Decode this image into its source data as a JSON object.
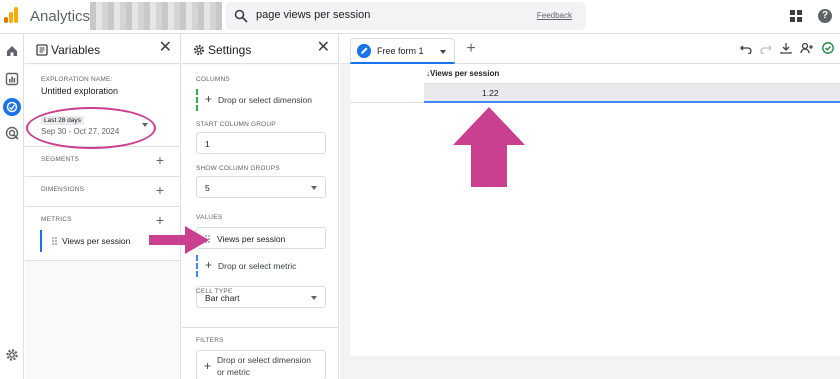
{
  "app": {
    "name": "Analytics"
  },
  "search": {
    "query": "page views per session",
    "feedback_label": "Feedback"
  },
  "variables": {
    "title": "Variables",
    "exploration_label": "EXPLORATION NAME:",
    "exploration_name": "Untitled exploration",
    "date_chip": "Last 28 days",
    "date_range": "Sep 30 - Oct 27, 2024",
    "segments_label": "SEGMENTS",
    "dimensions_label": "DIMENSIONS",
    "metrics_label": "METRICS",
    "metric_item": "Views per session"
  },
  "settings": {
    "title": "Settings",
    "columns_label": "COLUMNS",
    "columns_drop": "Drop or select dimension",
    "start_col_label": "START COLUMN GROUP",
    "start_col_value": "1",
    "show_groups_label": "SHOW COLUMN GROUPS",
    "show_groups_value": "5",
    "values_label": "VALUES",
    "value_item": "Views per session",
    "values_drop": "Drop or select metric",
    "cell_type_label": "CELL TYPE",
    "cell_type_value": "Bar chart",
    "filters_label": "FILTERS",
    "filters_drop_1": "Drop or select dimension",
    "filters_drop_2": "or metric"
  },
  "canvas": {
    "tab_label": "Free form 1",
    "column_header": "Views per session",
    "cell_value": "1.22"
  },
  "icons": [
    "logo-icon",
    "search-icon",
    "apps-icon",
    "help-icon",
    "home-icon",
    "reports-icon",
    "explore-icon",
    "advertising-icon",
    "admin-gear-icon",
    "undo-icon",
    "redo-icon",
    "download-icon",
    "share-icon",
    "check-icon"
  ],
  "colors": {
    "accent": "#1a73e8",
    "annotation": "#c8408f",
    "logo_orange": "#f9ab00",
    "logo_dark": "#e37400"
  }
}
